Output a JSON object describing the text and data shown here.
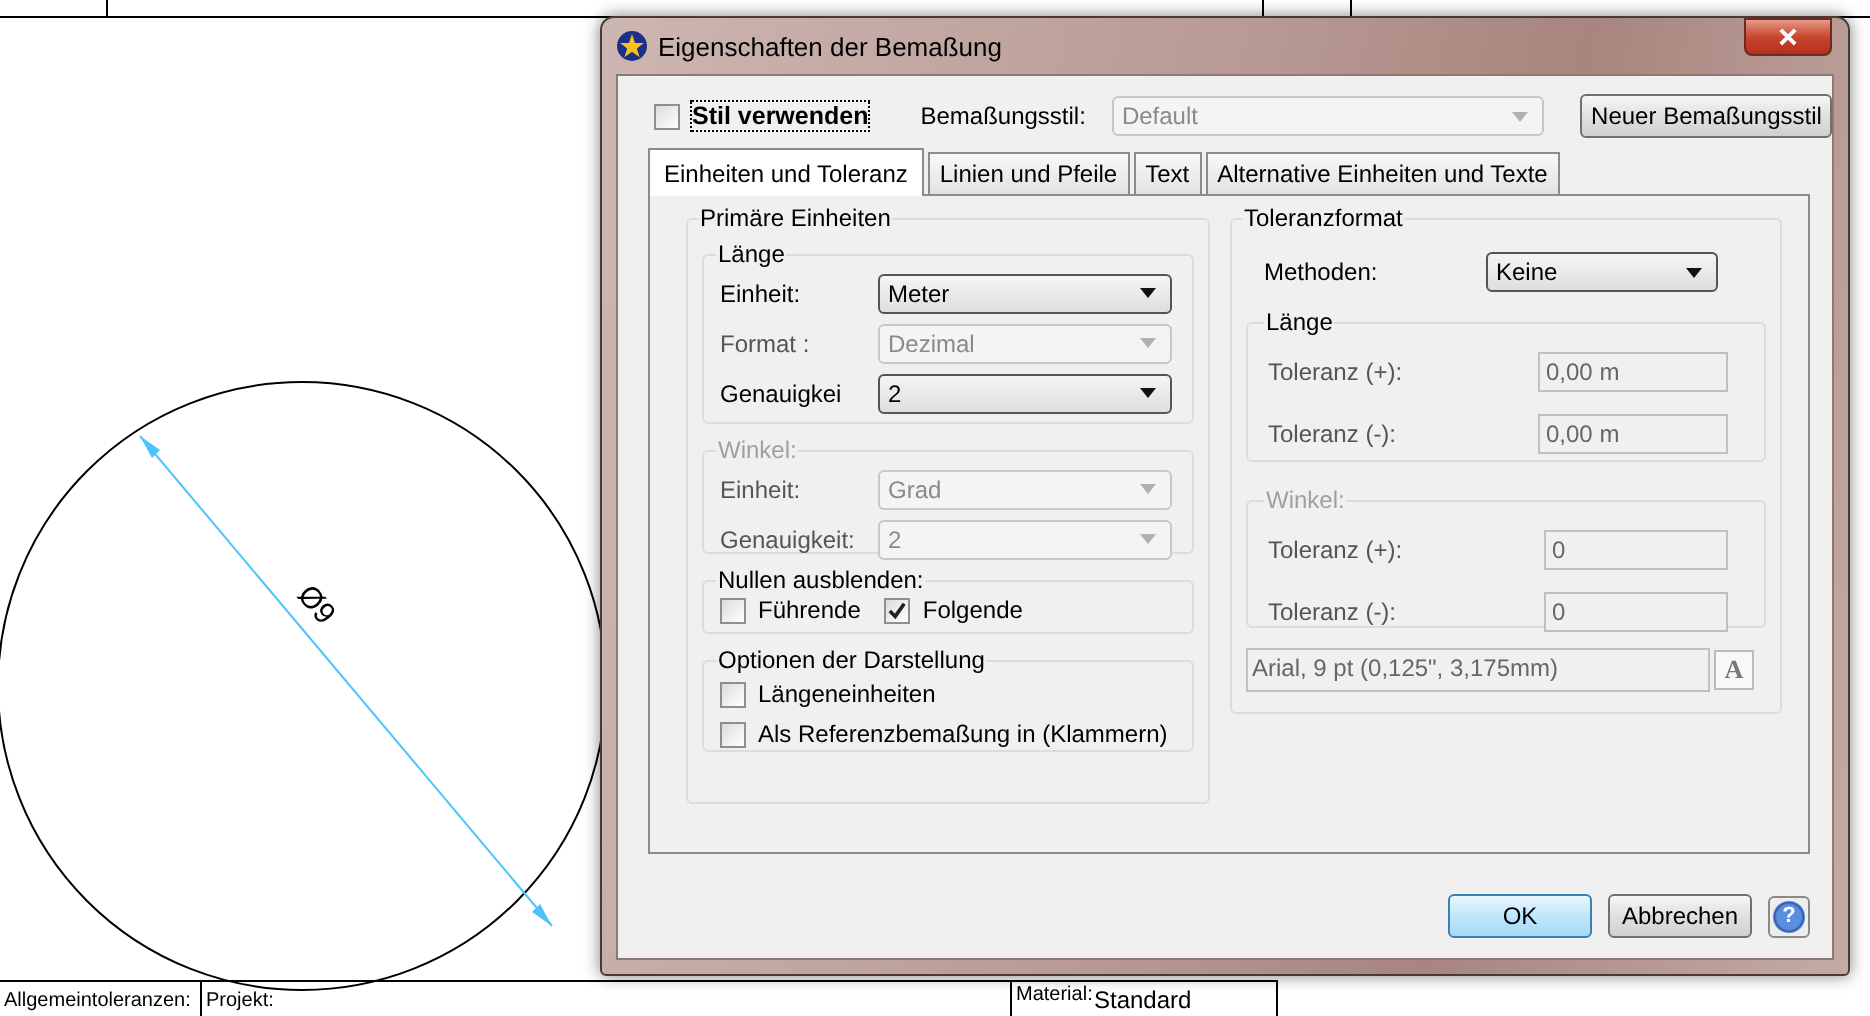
{
  "drawing": {
    "dimension": "Ø9",
    "title_block": [
      {
        "label": "Allgemeintoleranzen:"
      },
      {
        "label": "Projekt:"
      },
      {
        "label": "Material:",
        "value": "Standard"
      }
    ]
  },
  "dialog": {
    "title": "Eigenschaften der Bemaßung",
    "use_style": {
      "label": "Stil verwenden",
      "checked": false
    },
    "style_field": {
      "label": "Bemaßungsstil:",
      "value": "Default",
      "disabled": true
    },
    "new_style_button": "Neuer Bemaßungsstil",
    "tabs": [
      {
        "label": "Einheiten und Toleranz",
        "selected": true
      },
      {
        "label": "Linien und Pfeile",
        "selected": false
      },
      {
        "label": "Text",
        "selected": false
      },
      {
        "label": "Alternative Einheiten und Texte",
        "selected": false
      }
    ],
    "primary_units": {
      "title": "Primäre Einheiten",
      "length": {
        "title": "Länge",
        "disabled": false,
        "fields": [
          {
            "label": "Einheit:",
            "value": "Meter",
            "disabled": false
          },
          {
            "label": "Format :",
            "value": "Dezimal",
            "disabled": true
          },
          {
            "label": "Genauigkei",
            "value": "2",
            "disabled": false
          }
        ]
      },
      "angle": {
        "title": "Winkel:",
        "disabled": true,
        "fields": [
          {
            "label": "Einheit:",
            "value": "Grad",
            "disabled": true
          },
          {
            "label": "Genauigkeit:",
            "value": "2",
            "disabled": true
          }
        ]
      },
      "zeros": {
        "title": "Nullen ausblenden:",
        "options": [
          {
            "label": "Führende",
            "checked": false
          },
          {
            "label": "Folgende",
            "checked": true
          }
        ]
      },
      "display": {
        "title": "Optionen der Darstellung",
        "options": [
          {
            "label": "Längeneinheiten",
            "checked": false
          },
          {
            "label": "Als Referenzbemaßung in (Klammern)",
            "checked": false
          }
        ]
      }
    },
    "tolerance": {
      "title": "Toleranzformat",
      "method": {
        "label": "Methoden:",
        "value": "Keine"
      },
      "length": {
        "title": "Länge",
        "disabled": false,
        "fields": [
          {
            "label": "Toleranz (+):",
            "value": "0,00 m",
            "disabled": true
          },
          {
            "label": "Toleranz (-):",
            "value": "0,00 m",
            "disabled": true
          }
        ]
      },
      "angle": {
        "title": "Winkel:",
        "disabled": true,
        "fields": [
          {
            "label": "Toleranz (+):",
            "value": "0",
            "disabled": true
          },
          {
            "label": "Toleranz (-):",
            "value": "0",
            "disabled": true
          }
        ]
      },
      "font": {
        "value": "Arial, 9 pt (0,125\", 3,175mm)",
        "button": "A"
      }
    },
    "buttons": [
      {
        "label": "OK",
        "default": true
      },
      {
        "label": "Abbrechen",
        "default": false
      }
    ],
    "help_button": "?"
  }
}
